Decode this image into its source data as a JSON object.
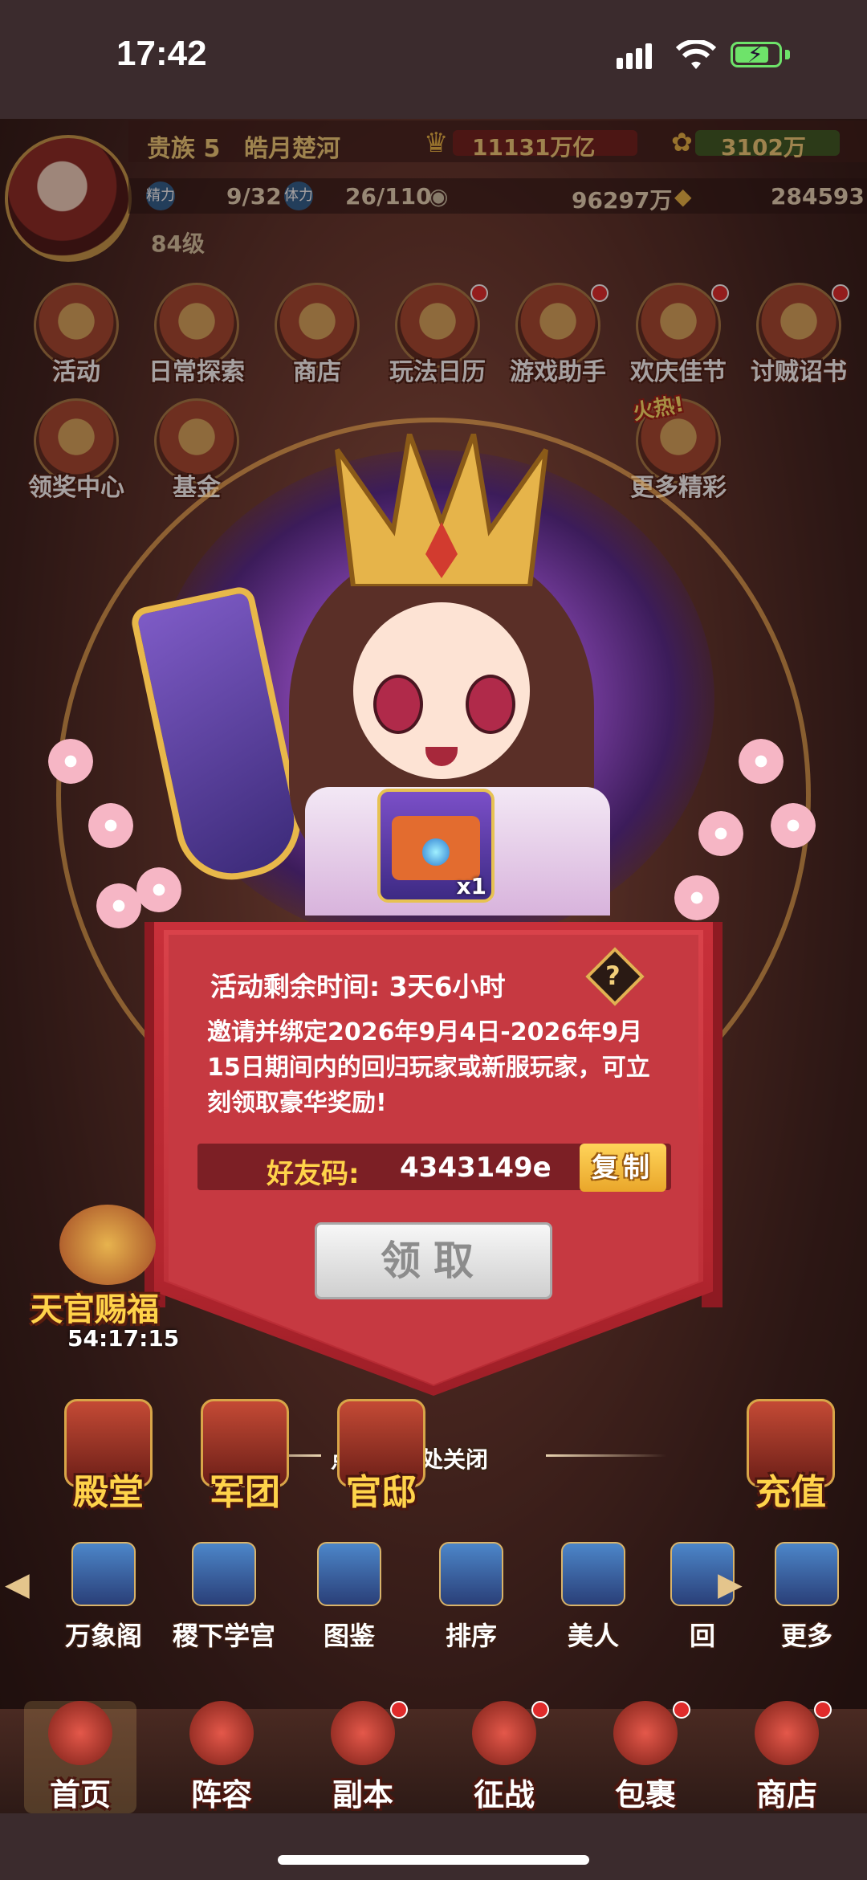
{
  "status_bar": {
    "time": "17:42"
  },
  "player": {
    "noble": "贵族 5",
    "name": "皓月楚河",
    "gold": "11131万亿",
    "power_score": "3102万",
    "stamina_label": "精力",
    "stamina": "9/32",
    "energy_label": "体力",
    "energy": "26/110",
    "coins": "96297万",
    "ingots": "284593",
    "level": "84级"
  },
  "menu_row1": [
    "活动",
    "日常探索",
    "商店",
    "玩法日历",
    "游戏助手",
    "欢庆佳节",
    "讨贼诏书"
  ],
  "menu_row2": {
    "left": "领奖中心",
    "second": "基金",
    "right": "更多精彩",
    "hot_tag": "火热!"
  },
  "reward": {
    "count": "x1"
  },
  "dialog": {
    "timer_label": "活动剩余时间: 3天6小时",
    "help_icon": "?",
    "description": "邀请并绑定2026年9月4日-2026年9月15日期间内的回归玩家或新服玩家，可立刻领取豪华奖励!",
    "friend_code_label": "好友码:",
    "friend_code": "4343149e",
    "copy_label": "复制",
    "claim_label": "领取"
  },
  "close_hint": "点击空白处关闭",
  "event": {
    "title": "天官赐福",
    "timer": "54:17:15"
  },
  "big_buttons": [
    "殿堂",
    "军团",
    "官邸",
    "充值"
  ],
  "features": [
    "万象阁",
    "稷下学宫",
    "图鉴",
    "排序",
    "美人",
    "回"
  ],
  "more_label": "更多",
  "tabs": [
    "首页",
    "阵容",
    "副本",
    "征战",
    "包裹",
    "商店"
  ],
  "colors": {
    "accent_gold": "#ffd34a",
    "dialog_red": "#c63941",
    "badge_red": "#e02b2b"
  }
}
